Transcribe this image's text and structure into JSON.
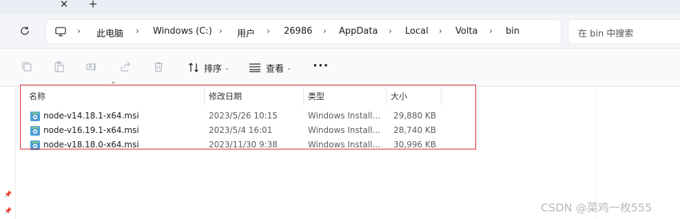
{
  "tabbar": {
    "close_glyph": "✕",
    "add_glyph": "+"
  },
  "breadcrumb": {
    "items": [
      "此电脑",
      "Windows (C:)",
      "用户",
      "26986",
      "AppData",
      "Local",
      "Volta",
      "bin"
    ],
    "separator": "›"
  },
  "search": {
    "placeholder": "在 bin 中搜索"
  },
  "toolbar": {
    "sort_label": "排序",
    "view_label": "查看",
    "more_label": "···",
    "icons": [
      "copy-icon",
      "paste-icon",
      "rename-icon",
      "share-icon",
      "delete-icon"
    ]
  },
  "file_list": {
    "sort_indicator": "⌃",
    "columns": [
      "名称",
      "修改日期",
      "类型",
      "大小"
    ],
    "rows": [
      {
        "name": "node-v14.18.1-x64.msi",
        "date": "2023/5/26 10:15",
        "type": "Windows Install...",
        "size": "29,880 KB"
      },
      {
        "name": "node-v16.19.1-x64.msi",
        "date": "2023/5/4 16:01",
        "type": "Windows Install...",
        "size": "28,740 KB"
      },
      {
        "name": "node-v18.18.0-x64.msi",
        "date": "2023/11/30 9:38",
        "type": "Windows Install...",
        "size": "30,996 KB"
      }
    ]
  },
  "watermark": "CSDN @菜鸡一枚555",
  "colors": {
    "highlight_box": "#d9282f",
    "accent": "#0067c0"
  }
}
